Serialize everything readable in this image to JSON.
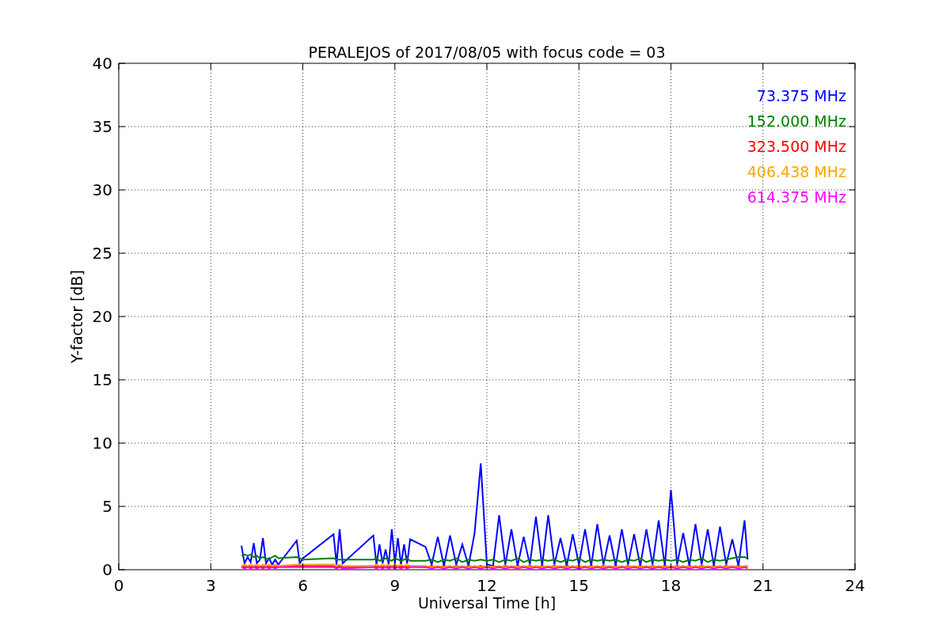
{
  "chart_data": {
    "type": "line",
    "grid": true,
    "title": "PERALEJOS of 2017/08/05 with focus code = 03",
    "xlabel": "Universal Time [h]",
    "ylabel": "Y-factor [dB]",
    "xlim": [
      0,
      24
    ],
    "ylim": [
      0,
      40
    ],
    "xticks": [
      0,
      3,
      6,
      9,
      12,
      15,
      18,
      21,
      24
    ],
    "yticks": [
      0,
      5,
      10,
      15,
      20,
      25,
      30,
      35,
      40
    ],
    "x": [
      4.0,
      4.1,
      4.2,
      4.3,
      4.4,
      4.5,
      4.6,
      4.7,
      4.8,
      4.9,
      5.0,
      5.1,
      5.2,
      5.8,
      5.9,
      6.0,
      7.0,
      7.1,
      7.2,
      7.3,
      8.3,
      8.4,
      8.5,
      8.6,
      8.7,
      8.8,
      8.9,
      9.0,
      9.1,
      9.2,
      9.3,
      9.4,
      9.5,
      10.0,
      10.2,
      10.4,
      10.6,
      10.8,
      11.0,
      11.2,
      11.4,
      11.6,
      11.8,
      12.0,
      12.2,
      12.4,
      12.6,
      12.8,
      13.0,
      13.2,
      13.4,
      13.6,
      13.8,
      14.0,
      14.2,
      14.4,
      14.6,
      14.8,
      15.0,
      15.2,
      15.4,
      15.6,
      15.8,
      16.0,
      16.2,
      16.4,
      16.6,
      16.8,
      17.0,
      17.2,
      17.4,
      17.6,
      17.8,
      18.0,
      18.2,
      18.4,
      18.6,
      18.8,
      19.0,
      19.2,
      19.4,
      19.6,
      19.8,
      20.0,
      20.2,
      20.4,
      20.5
    ],
    "series": [
      {
        "name": "73.375 MHz",
        "color": "#0000ff",
        "values": [
          1.9,
          0.5,
          1.0,
          0.6,
          2.1,
          0.5,
          0.8,
          2.5,
          0.5,
          0.9,
          0.4,
          0.8,
          0.4,
          2.3,
          0.5,
          0.9,
          2.8,
          0.4,
          3.2,
          0.5,
          2.7,
          0.4,
          2.0,
          0.5,
          1.6,
          0.4,
          3.2,
          0.5,
          2.5,
          0.4,
          2.0,
          0.5,
          2.4,
          1.8,
          0.4,
          2.6,
          0.3,
          2.7,
          0.4,
          2.0,
          0.3,
          2.9,
          8.4,
          0.4,
          0.3,
          4.3,
          0.4,
          3.2,
          0.3,
          2.6,
          0.4,
          4.2,
          0.3,
          4.3,
          0.4,
          2.5,
          0.3,
          2.8,
          0.4,
          3.2,
          0.3,
          3.6,
          0.4,
          2.7,
          0.3,
          3.2,
          0.4,
          2.8,
          0.3,
          3.2,
          0.4,
          3.9,
          0.3,
          6.3,
          0.4,
          2.9,
          0.3,
          3.6,
          0.4,
          3.2,
          0.3,
          3.4,
          0.4,
          2.4,
          0.3,
          3.9,
          0.8
        ]
      },
      {
        "name": "152.000 MHz",
        "color": "#008000",
        "values": [
          1.1,
          1.2,
          1.1,
          1.2,
          1.0,
          1.1,
          0.9,
          1.0,
          0.9,
          0.8,
          1.0,
          1.1,
          0.9,
          1.0,
          0.9,
          0.8,
          0.9,
          0.8,
          0.8,
          0.8,
          0.8,
          0.9,
          0.7,
          0.8,
          0.9,
          0.8,
          0.7,
          0.9,
          0.8,
          0.7,
          0.8,
          0.9,
          0.7,
          0.7,
          0.8,
          0.6,
          0.8,
          0.7,
          0.9,
          0.6,
          0.8,
          0.7,
          0.8,
          0.7,
          0.8,
          0.6,
          0.8,
          0.7,
          0.9,
          0.6,
          0.8,
          0.7,
          0.8,
          0.7,
          0.8,
          0.6,
          0.8,
          0.7,
          0.9,
          0.6,
          0.8,
          0.7,
          0.8,
          0.7,
          0.8,
          0.6,
          0.8,
          0.7,
          0.9,
          0.6,
          0.8,
          0.7,
          0.8,
          0.7,
          0.8,
          0.6,
          0.8,
          0.7,
          0.9,
          0.6,
          0.8,
          0.7,
          0.8,
          0.9,
          1.0,
          1.0,
          0.9
        ]
      },
      {
        "name": "323.500 MHz",
        "color": "#ff0000",
        "values": [
          0.3,
          0.2,
          0.3,
          0.2,
          0.3,
          0.2,
          0.3,
          0.2,
          0.3,
          0.2,
          0.3,
          0.2,
          0.3,
          0.3,
          0.3,
          0.3,
          0.3,
          0.2,
          0.3,
          0.2,
          0.3,
          0.2,
          0.3,
          0.2,
          0.3,
          0.2,
          0.3,
          0.2,
          0.3,
          0.2,
          0.3,
          0.2,
          0.3,
          0.2,
          0.3,
          0.2,
          0.3,
          0.2,
          0.3,
          0.2,
          0.3,
          0.2,
          0.3,
          0.2,
          0.3,
          0.2,
          0.3,
          0.2,
          0.3,
          0.2,
          0.3,
          0.2,
          0.3,
          0.2,
          0.3,
          0.2,
          0.3,
          0.2,
          0.3,
          0.2,
          0.3,
          0.2,
          0.3,
          0.2,
          0.3,
          0.2,
          0.3,
          0.2,
          0.3,
          0.2,
          0.3,
          0.2,
          0.3,
          0.2,
          0.3,
          0.2,
          0.3,
          0.2,
          0.3,
          0.2,
          0.3,
          0.2,
          0.3,
          0.2,
          0.3,
          0.2,
          0.3
        ]
      },
      {
        "name": "406.438 MHz",
        "color": "#ffa500",
        "values": [
          0.3,
          0.4,
          0.3,
          0.4,
          0.3,
          0.4,
          0.3,
          0.4,
          0.3,
          0.4,
          0.3,
          0.4,
          0.3,
          0.4,
          0.4,
          0.4,
          0.4,
          0.3,
          0.4,
          0.3,
          0.3,
          0.4,
          0.3,
          0.4,
          0.3,
          0.4,
          0.3,
          0.4,
          0.3,
          0.4,
          0.3,
          0.4,
          0.3,
          0.3,
          0.2,
          0.3,
          0.2,
          0.3,
          0.2,
          0.3,
          0.2,
          0.3,
          0.2,
          0.3,
          0.2,
          0.3,
          0.2,
          0.3,
          0.2,
          0.3,
          0.2,
          0.3,
          0.2,
          0.3,
          0.2,
          0.3,
          0.2,
          0.3,
          0.2,
          0.3,
          0.2,
          0.3,
          0.2,
          0.3,
          0.2,
          0.3,
          0.2,
          0.3,
          0.2,
          0.3,
          0.2,
          0.3,
          0.2,
          0.3,
          0.2,
          0.3,
          0.2,
          0.3,
          0.2,
          0.3,
          0.2,
          0.3,
          0.2,
          0.3,
          0.2,
          0.3,
          0.3
        ]
      },
      {
        "name": "614.375 MHz",
        "color": "#ff00ff",
        "values": [
          0.2,
          0.1,
          0.2,
          0.1,
          0.2,
          0.1,
          0.2,
          0.1,
          0.2,
          0.1,
          0.2,
          0.1,
          0.2,
          0.2,
          0.2,
          0.2,
          0.2,
          0.1,
          0.2,
          0.1,
          0.2,
          0.1,
          0.2,
          0.1,
          0.2,
          0.1,
          0.2,
          0.1,
          0.2,
          0.1,
          0.2,
          0.1,
          0.2,
          0.2,
          0.1,
          0.2,
          0.1,
          0.2,
          0.1,
          0.2,
          0.1,
          0.2,
          0.1,
          0.2,
          0.1,
          0.2,
          0.1,
          0.2,
          0.1,
          0.2,
          0.1,
          0.2,
          0.1,
          0.2,
          0.1,
          0.2,
          0.1,
          0.2,
          0.1,
          0.2,
          0.1,
          0.2,
          0.1,
          0.2,
          0.1,
          0.2,
          0.1,
          0.2,
          0.1,
          0.2,
          0.1,
          0.2,
          0.1,
          0.2,
          0.1,
          0.2,
          0.1,
          0.2,
          0.1,
          0.2,
          0.1,
          0.2,
          0.1,
          0.2,
          0.1,
          0.2,
          0.1
        ]
      }
    ]
  }
}
